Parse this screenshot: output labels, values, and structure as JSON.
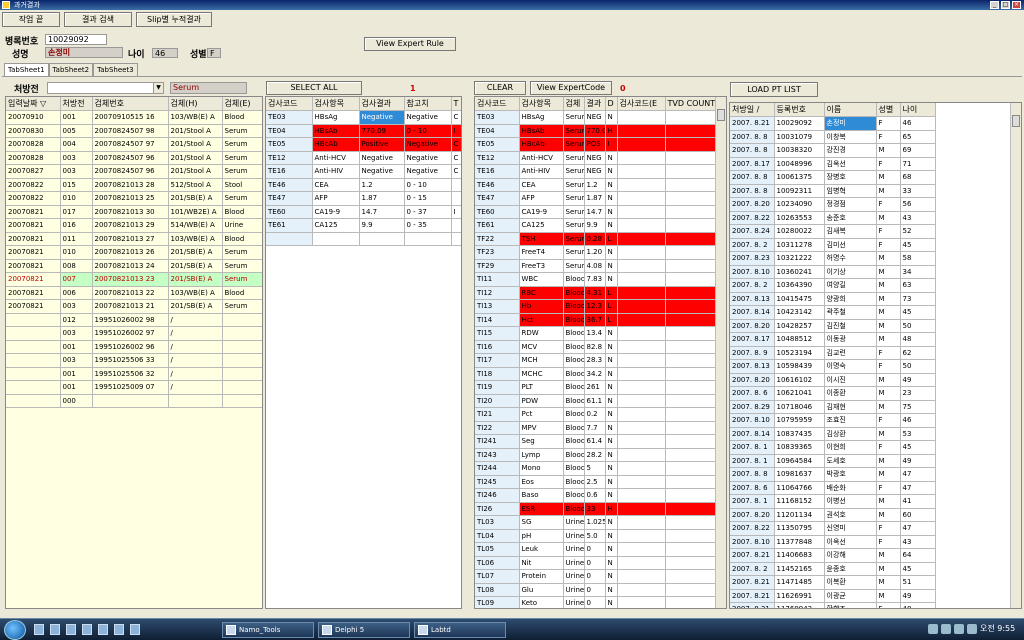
{
  "window": {
    "title": "과거결과",
    "controls": [
      "_",
      "□",
      "×"
    ]
  },
  "toolbar": {
    "btn1": "작업 끝",
    "btn2": "결과 검색",
    "btn3": "Slip별 누적결과"
  },
  "patient": {
    "chart_label": "병록번호",
    "chart_no": "10029092",
    "name_label": "성명",
    "name": "손정미",
    "age_label": "나이",
    "age": "46",
    "sex_label": "성별",
    "sex": "F"
  },
  "expert_btn": "View Expert Rule",
  "tabs": [
    "TabSheet1",
    "TabSheet2",
    "TabSheet3"
  ],
  "left": {
    "prescriber_label": "처방전",
    "prescriber_value": "",
    "dropdown_arrow": "▼",
    "specimen": "Serum"
  },
  "controls": {
    "select_all": "SELECT ALL",
    "count1": "1",
    "clear": "CLEAR",
    "view_expert_code": "View ExpertCode",
    "count2": "0",
    "load_pt": "LOAD PT LIST"
  },
  "g1": {
    "headers": [
      "입력날짜 ▽",
      "처방전",
      "검체번호",
      "검체(H)",
      "검체(E)"
    ],
    "rows": [
      [
        "20070910",
        "001",
        "20070910515 16",
        "103/WB(E) A",
        "Blood"
      ],
      [
        "20070830",
        "005",
        "20070824507 98",
        "201/Stool A",
        "Serum"
      ],
      [
        "20070828",
        "004",
        "20070824507 97",
        "201/Stool A",
        "Serum"
      ],
      [
        "20070828",
        "003",
        "20070824507 96",
        "201/Stool A",
        "Serum"
      ],
      [
        "20070827",
        "003",
        "20070824507 96",
        "201/Stool A",
        "Serum"
      ],
      [
        "20070822",
        "015",
        "20070821013 28",
        "512/Stool A",
        "Stool"
      ],
      [
        "20070822",
        "010",
        "20070821013 25",
        "201/SB(E) A",
        "Serum"
      ],
      [
        "20070821",
        "017",
        "20070821013 30",
        "101/WB2E) A",
        "Blood"
      ],
      [
        "20070821",
        "016",
        "20070821013 29",
        "514/WB(E) A",
        "Urine"
      ],
      [
        "20070821",
        "011",
        "20070821013 27",
        "103/WB(E) A",
        "Blood"
      ],
      [
        "20070821",
        "010",
        "20070821013 26",
        "201/SB(E) A",
        "Serum"
      ],
      [
        "20070821",
        "008",
        "20070821013 24",
        "201/SB(E) A",
        "Serum"
      ],
      [
        "20070821",
        "007",
        "20070821013 23",
        "201/SB(E) A",
        "Serum"
      ],
      [
        "20070821",
        "006",
        "20070821013 22",
        "103/WB(E) A",
        "Blood"
      ],
      [
        "20070821",
        "003",
        "20070821013 21",
        "201/SB(E) A",
        "Serum"
      ],
      [
        "",
        "012",
        "19951026002 98",
        "/",
        ""
      ],
      [
        "",
        "003",
        "19951026002 97",
        "/",
        ""
      ],
      [
        "",
        "001",
        "19951026002 96",
        "/",
        ""
      ],
      [
        "",
        "003",
        "19951025506 33",
        "/",
        ""
      ],
      [
        "",
        "001",
        "19951025506 32",
        "/",
        ""
      ],
      [
        "",
        "001",
        "19951025009 07",
        "/",
        ""
      ],
      [
        "",
        "000",
        "",
        "",
        ""
      ]
    ]
  },
  "g2": {
    "headers": [
      "검사코드",
      "검사항목",
      "검사결과",
      "참고치",
      "T"
    ],
    "rows": [
      [
        "TE03",
        "HBsAg",
        "Negative",
        "Negative",
        "C"
      ],
      [
        "TE04",
        "HBsAb",
        "770.09",
        "0 - 10",
        "I"
      ],
      [
        "TE05",
        "HBcAb",
        "Positive",
        "Negative",
        "C"
      ],
      [
        "TE12",
        "Anti-HCV",
        "Negative",
        "Negative",
        "C"
      ],
      [
        "TE16",
        "Anti-HIV",
        "Negative",
        "Negative",
        "C"
      ],
      [
        "TE46",
        "CEA",
        "1.2",
        "0 - 10",
        ""
      ],
      [
        "TE47",
        "AFP",
        "1.87",
        "0 - 15",
        ""
      ],
      [
        "TE60",
        "CA19-9",
        "14.7",
        "0 - 37",
        "I"
      ],
      [
        "TE61",
        "CA125",
        "9.9",
        "0 - 35",
        ""
      ],
      [
        "",
        "",
        "",
        "",
        ""
      ]
    ]
  },
  "g3": {
    "headers": [
      "검사코드",
      "검사항목",
      "검체",
      "결과",
      "D",
      "검사코드(E",
      "TVD COUNT"
    ],
    "rows": [
      [
        "TE03",
        "HBsAg",
        "Serum",
        "NEG",
        "N",
        "",
        ""
      ],
      [
        "TE04",
        "HBsAb",
        "Serum",
        "770.0",
        "H",
        "",
        ""
      ],
      [
        "TE05",
        "HBcAb",
        "Serum",
        "POS",
        "I",
        "",
        ""
      ],
      [
        "TE12",
        "Anti-HCV",
        "Serum",
        "NEG",
        "N",
        "",
        ""
      ],
      [
        "TE16",
        "Anti-HIV",
        "Serum",
        "NEG",
        "N",
        "",
        ""
      ],
      [
        "TE46",
        "CEA",
        "Serum",
        "1.2",
        "N",
        "",
        ""
      ],
      [
        "TE47",
        "AFP",
        "Serum",
        "1.87",
        "N",
        "",
        ""
      ],
      [
        "TE60",
        "CA19-9",
        "Serum",
        "14.7",
        "N",
        "",
        ""
      ],
      [
        "TE61",
        "CA125",
        "Serum",
        "9.9",
        "N",
        "",
        ""
      ],
      [
        "TF22",
        "TSH",
        "Serum",
        "0.28",
        "L",
        "",
        ""
      ],
      [
        "TF23",
        "FreeT4",
        "Serum",
        "1.20",
        "N",
        "",
        ""
      ],
      [
        "TF29",
        "FreeT3",
        "Serum",
        "4.08",
        "N",
        "",
        ""
      ],
      [
        "TI11",
        "WBC",
        "Blood",
        "7.83",
        "N",
        "",
        ""
      ],
      [
        "TI12",
        "RBC",
        "Blood",
        "4.31",
        "L",
        "",
        ""
      ],
      [
        "TI13",
        "Hb",
        "Blood",
        "12.3",
        "L",
        "",
        ""
      ],
      [
        "TI14",
        "Hct",
        "Blood",
        "36.7",
        "L",
        "",
        ""
      ],
      [
        "TI15",
        "RDW",
        "Blood",
        "13.4",
        "N",
        "",
        ""
      ],
      [
        "TI16",
        "MCV",
        "Blood",
        "82.8",
        "N",
        "",
        ""
      ],
      [
        "TI17",
        "MCH",
        "Blood",
        "28.3",
        "N",
        "",
        ""
      ],
      [
        "TI18",
        "MCHC",
        "Blood",
        "34.2",
        "N",
        "",
        ""
      ],
      [
        "TI19",
        "PLT",
        "Blood",
        "261",
        "N",
        "",
        ""
      ],
      [
        "TI20",
        "PDW",
        "Blood",
        "61.1",
        "N",
        "",
        ""
      ],
      [
        "TI21",
        "Pct",
        "Blood",
        "0.2",
        "N",
        "",
        ""
      ],
      [
        "TI22",
        "MPV",
        "Blood",
        "7.7",
        "N",
        "",
        ""
      ],
      [
        "TI241",
        "Seg",
        "Blood",
        "61.4",
        "N",
        "",
        ""
      ],
      [
        "TI243",
        "Lymp",
        "Blood",
        "28.2",
        "N",
        "",
        ""
      ],
      [
        "TI244",
        "Mono",
        "Blood",
        "5",
        "N",
        "",
        ""
      ],
      [
        "TI245",
        "Eos",
        "Blood",
        "2.5",
        "N",
        "",
        ""
      ],
      [
        "TI246",
        "Baso",
        "Blood",
        "0.6",
        "N",
        "",
        ""
      ],
      [
        "TI26",
        "ESR",
        "Blood",
        "33",
        "H",
        "",
        ""
      ],
      [
        "TL03",
        "SG",
        "Urine",
        "1.025",
        "N",
        "",
        ""
      ],
      [
        "TL04",
        "pH",
        "Urine",
        "5.0",
        "N",
        "",
        ""
      ],
      [
        "TL05",
        "Leuk",
        "Urine",
        "0",
        "N",
        "",
        ""
      ],
      [
        "TL06",
        "Nit",
        "Urine",
        "0",
        "N",
        "",
        ""
      ],
      [
        "TL07",
        "Protein",
        "Urine",
        "0",
        "N",
        "",
        ""
      ],
      [
        "TL08",
        "Glu",
        "Urine",
        "0",
        "N",
        "",
        ""
      ],
      [
        "TL09",
        "Keto",
        "Urine",
        "0",
        "N",
        "",
        ""
      ]
    ]
  },
  "g4": {
    "headers": [
      "처방일 /",
      "등록번호",
      "이름",
      "성별",
      "나이"
    ],
    "rows": [
      [
        "2007. 8.21",
        "10029092",
        "손정미",
        "F",
        "46"
      ],
      [
        "2007. 8. 8",
        "10031079",
        "이창복",
        "F",
        "65"
      ],
      [
        "2007. 8. 8",
        "10038320",
        "강진경",
        "M",
        "69"
      ],
      [
        "2007. 8.17",
        "10048996",
        "김옥선",
        "F",
        "71"
      ],
      [
        "2007. 8. 8",
        "10061375",
        "장병호",
        "M",
        "68"
      ],
      [
        "2007. 8. 8",
        "10092311",
        "임병혁",
        "M",
        "33"
      ],
      [
        "2007. 8.20",
        "10234090",
        "정경점",
        "F",
        "56"
      ],
      [
        "2007. 8.22",
        "10263553",
        "송준호",
        "M",
        "43"
      ],
      [
        "2007. 8.24",
        "10280022",
        "김새복",
        "F",
        "52"
      ],
      [
        "2007. 8. 2",
        "10311278",
        "김미선",
        "F",
        "45"
      ],
      [
        "2007. 8.23",
        "10321222",
        "허명수",
        "M",
        "58"
      ],
      [
        "2007. 8.10",
        "10360241",
        "이기상",
        "M",
        "34"
      ],
      [
        "2007. 8. 2",
        "10364390",
        "여양길",
        "M",
        "63"
      ],
      [
        "2007. 8.13",
        "10415475",
        "양광희",
        "M",
        "73"
      ],
      [
        "2007. 8.14",
        "10423142",
        "곽주철",
        "M",
        "45"
      ],
      [
        "2007. 8.20",
        "10428257",
        "김진철",
        "M",
        "50"
      ],
      [
        "2007. 8.17",
        "10488512",
        "이동광",
        "M",
        "48"
      ],
      [
        "2007. 8. 9",
        "10523194",
        "김교련",
        "F",
        "62"
      ],
      [
        "2007. 8.13",
        "10598439",
        "이명숙",
        "F",
        "50"
      ],
      [
        "2007. 8.20",
        "10616102",
        "이시진",
        "M",
        "49"
      ],
      [
        "2007. 8. 6",
        "10621041",
        "이종환",
        "M",
        "23"
      ],
      [
        "2007. 8.29",
        "10718046",
        "김재현",
        "M",
        "75"
      ],
      [
        "2007. 8.10",
        "10795959",
        "조효진",
        "F",
        "46"
      ],
      [
        "2007. 8.14",
        "10837435",
        "김상환",
        "M",
        "53"
      ],
      [
        "2007. 8. 1",
        "10839365",
        "이현희",
        "F",
        "45"
      ],
      [
        "2007. 8. 1",
        "10964584",
        "도세호",
        "M",
        "49"
      ],
      [
        "2007. 8. 8",
        "10981637",
        "박광호",
        "M",
        "47"
      ],
      [
        "2007. 8. 6",
        "11064766",
        "배순화",
        "F",
        "47"
      ],
      [
        "2007. 8. 1",
        "11168152",
        "이병선",
        "M",
        "41"
      ],
      [
        "2007. 8.20",
        "11201134",
        "권석호",
        "M",
        "60"
      ],
      [
        "2007. 8.22",
        "11350795",
        "신영미",
        "F",
        "47"
      ],
      [
        "2007. 8.10",
        "11377848",
        "이옥선",
        "F",
        "43"
      ],
      [
        "2007. 8.21",
        "11406683",
        "이강해",
        "M",
        "64"
      ],
      [
        "2007. 8. 2",
        "11452165",
        "윤종호",
        "M",
        "45"
      ],
      [
        "2007. 8.21",
        "11471485",
        "이복환",
        "M",
        "51"
      ],
      [
        "2007. 8.21",
        "11626991",
        "이광균",
        "M",
        "49"
      ],
      [
        "2007. 8.21",
        "11769942",
        "황향조",
        "F",
        "48"
      ]
    ]
  },
  "taskbar": {
    "tasks": [
      "Namo_Tools",
      "Delphi 5",
      "Labtd"
    ],
    "clock": "오전 9:55"
  }
}
